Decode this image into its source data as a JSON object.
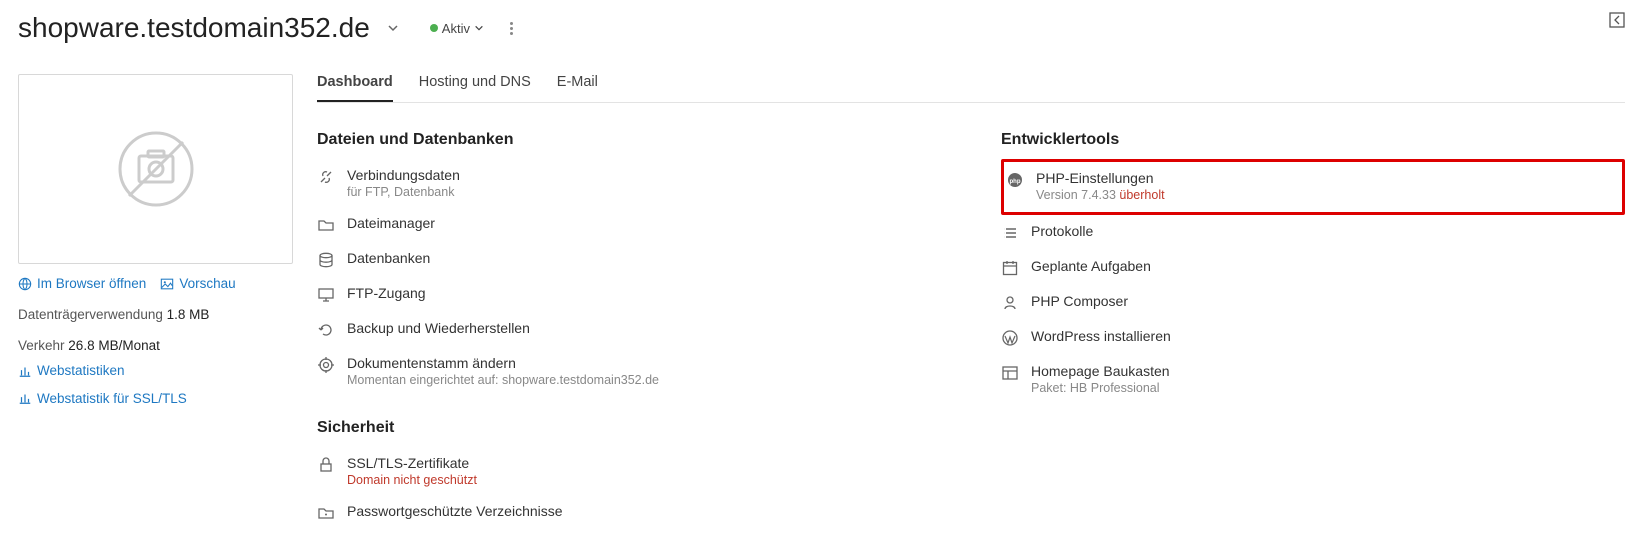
{
  "header": {
    "domain": "shopware.testdomain352.de",
    "status_label": "Aktiv"
  },
  "sidebar": {
    "open_browser": "Im Browser öffnen",
    "preview": "Vorschau",
    "disk_label": "Datenträgerverwendung",
    "disk_value": "1.8 MB",
    "traffic_label": "Verkehr",
    "traffic_value": "26.8 MB/Monat",
    "webstats": "Webstatistiken",
    "webstats_ssl": "Webstatistik für SSL/TLS"
  },
  "tabs": {
    "dashboard": "Dashboard",
    "hosting": "Hosting und DNS",
    "email": "E-Mail"
  },
  "files_section": {
    "title": "Dateien und Datenbanken",
    "connection": {
      "label": "Verbindungsdaten",
      "sub": "für FTP, Datenbank"
    },
    "filemanager": "Dateimanager",
    "databases": "Datenbanken",
    "ftp": "FTP-Zugang",
    "backup": "Backup und Wiederherstellen",
    "docroot": {
      "label": "Dokumentenstamm ändern",
      "sub": "Momentan eingerichtet auf: shopware.testdomain352.de"
    }
  },
  "security_section": {
    "title": "Sicherheit",
    "ssl": {
      "label": "SSL/TLS-Zertifikate",
      "sub": "Domain nicht geschützt"
    },
    "pwdirs": "Passwortgeschützte Verzeichnisse"
  },
  "dev_section": {
    "title": "Entwicklertools",
    "php": {
      "label": "PHP-Einstellungen",
      "sub_prefix": "Version 7.4.33 ",
      "sub_warn": "überholt"
    },
    "logs": "Protokolle",
    "tasks": "Geplante Aufgaben",
    "composer": "PHP Composer",
    "wordpress": "WordPress installieren",
    "sitebuilder": {
      "label": "Homepage Baukasten",
      "sub": "Paket: HB Professional"
    }
  }
}
